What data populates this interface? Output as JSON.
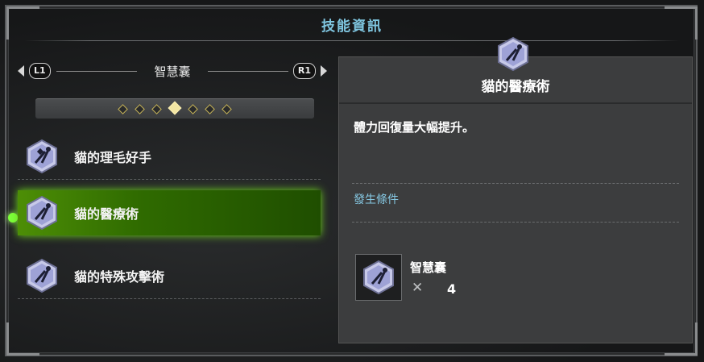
{
  "title": "技能資訊",
  "category": {
    "left_button": "L1",
    "right_button": "R1",
    "label": "智慧囊",
    "pages": 7,
    "active_page": 4
  },
  "skills": [
    {
      "label": "貓的理毛好手",
      "icon": "feline-tools-icon",
      "selected": false
    },
    {
      "label": "貓的醫療術",
      "icon": "feline-tools-icon",
      "selected": true
    },
    {
      "label": "貓的特殊攻擊術",
      "icon": "feline-tools-icon",
      "selected": false
    }
  ],
  "detail": {
    "title": "貓的醫療術",
    "description": "體力回復量大幅提升。",
    "condition_title": "發生條件",
    "requirement": {
      "name": "智慧囊",
      "x": "✕",
      "quantity": "4"
    }
  },
  "colors": {
    "accent": "#7fc6e0",
    "selected": "#4d8e06",
    "panel": "#3c3d3e"
  }
}
